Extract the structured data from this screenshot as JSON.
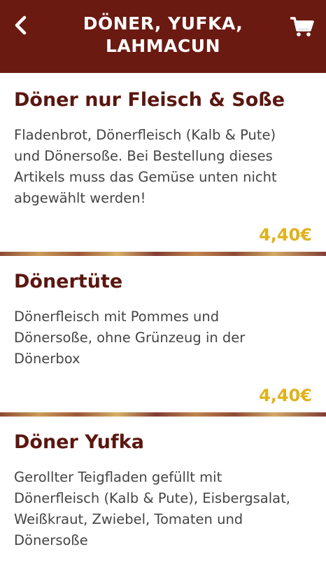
{
  "header": {
    "title_line1": "DÖNER, YUFKA,",
    "title_line2": "LAHMACUN",
    "back_icon": "chevron-left-icon",
    "cart_icon": "cart-icon",
    "background_color": "#6b1a12"
  },
  "colors": {
    "name": "#5a1710",
    "price": "#e0b21c",
    "description": "#444444"
  },
  "items": [
    {
      "name": "Döner nur Fleisch & Soße",
      "description_lines": [
        "Fladenbrot, Dönerfleisch (Kalb & Pute)",
        "und Dönersoße. Bei Bestellung dieses",
        "Artikels muss das Gemüse unten nicht",
        "abgewählt werden!"
      ],
      "price": "4,40€"
    },
    {
      "name": "Dönertüte",
      "description_lines": [
        "Dönerfleisch mit Pommes und",
        "Dönersoße, ohne Grünzeug in der",
        "Dönerbox"
      ],
      "price": "4,40€"
    },
    {
      "name": "Döner Yufka",
      "description_lines": [
        "Gerollter Teigfladen gefüllt mit",
        "Dönerfleisch (Kalb & Pute), Eisbergsalat,",
        "Weißkraut, Zwiebel, Tomaten und",
        "Dönersoße"
      ],
      "price": ""
    }
  ]
}
